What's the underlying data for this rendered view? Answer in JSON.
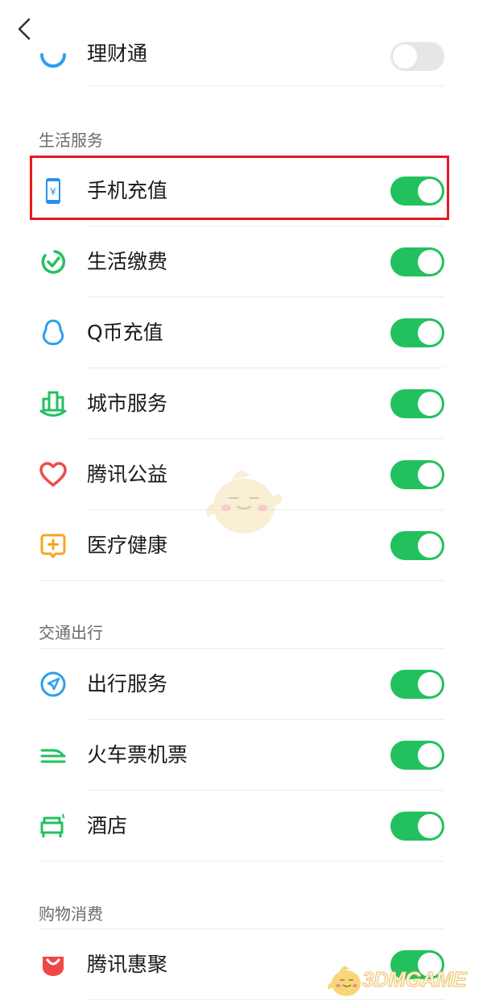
{
  "nav": {
    "back_icon": "chevron-left-icon"
  },
  "top_row": {
    "label": "理财通",
    "icon": "licaitong-icon",
    "enabled": false
  },
  "sections": {
    "life": {
      "title": "生活服务",
      "items": [
        {
          "label": "手机充值",
          "icon": "phone-yen-icon",
          "enabled": true,
          "highlighted": true
        },
        {
          "label": "生活缴费",
          "icon": "check-circle-icon",
          "enabled": true
        },
        {
          "label": "Q币充值",
          "icon": "penguin-icon",
          "enabled": true
        },
        {
          "label": "城市服务",
          "icon": "city-building-icon",
          "enabled": true
        },
        {
          "label": "腾讯公益",
          "icon": "heart-icon",
          "enabled": true
        },
        {
          "label": "医疗健康",
          "icon": "medical-cross-icon",
          "enabled": true
        }
      ]
    },
    "travel": {
      "title": "交通出行",
      "items": [
        {
          "label": "出行服务",
          "icon": "navigation-arrow-icon",
          "enabled": true
        },
        {
          "label": "火车票机票",
          "icon": "train-icon",
          "enabled": true
        },
        {
          "label": "酒店",
          "icon": "hotel-bed-icon",
          "enabled": true
        }
      ]
    },
    "shopping": {
      "title": "购物消费",
      "items": [
        {
          "label": "腾讯惠聚",
          "icon": "shopping-bag-icon",
          "enabled": true
        }
      ]
    }
  },
  "watermark": {
    "text": "3DMGAME"
  },
  "colors": {
    "toggle_on": "#22c15e",
    "highlight": "#e8191f",
    "section_text": "#6b6b6b"
  }
}
